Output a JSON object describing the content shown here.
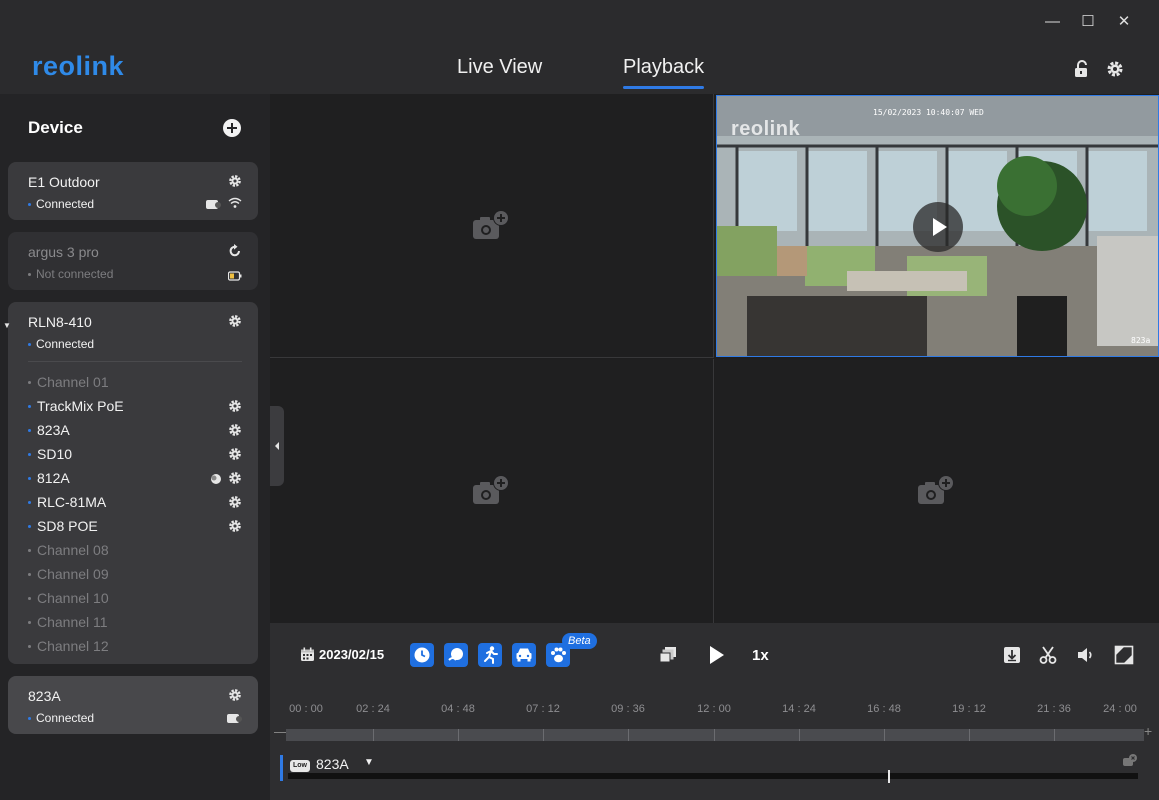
{
  "window_controls": {
    "minimize": "—",
    "maximize": "☐",
    "close": "✕"
  },
  "brand": {
    "logo_text": "reolink",
    "accent": "#2f7ae5"
  },
  "nav": {
    "live_view": "Live View",
    "playback": "Playback",
    "active": "Playback"
  },
  "sidebar": {
    "title": "Device",
    "devices": [
      {
        "name": "E1 Outdoor",
        "status": "Connected"
      },
      {
        "name": "argus 3 pro",
        "status": "Not connected"
      },
      {
        "name": "RLN8-410",
        "status": "Connected",
        "channels": [
          {
            "name": "Channel 01",
            "active": false
          },
          {
            "name": "TrackMix PoE",
            "active": true
          },
          {
            "name": "823A",
            "active": true
          },
          {
            "name": "SD10",
            "active": true
          },
          {
            "name": "812A",
            "active": true
          },
          {
            "name": "RLC-81MA",
            "active": true
          },
          {
            "name": "SD8 POE",
            "active": true
          },
          {
            "name": "Channel 08",
            "active": false
          },
          {
            "name": "Channel 09",
            "active": false
          },
          {
            "name": "Channel 10",
            "active": false
          },
          {
            "name": "Channel 11",
            "active": false
          },
          {
            "name": "Channel 12",
            "active": false
          }
        ]
      },
      {
        "name": "823A",
        "status": "Connected"
      }
    ]
  },
  "feed": {
    "timestamp": "15/02/2023 10:40:07 WED",
    "watermark": "reolink",
    "camera_label": "823a"
  },
  "controls": {
    "date": "2023/02/15",
    "beta_label": "Beta",
    "speed": "1x"
  },
  "timeline": {
    "labels": [
      "00 : 00",
      "02 : 24",
      "04 : 48",
      "07 : 12",
      "09 : 36",
      "12 : 00",
      "14 : 24",
      "16 : 48",
      "19 : 12",
      "21 : 36",
      "24 : 00"
    ],
    "minus": "—",
    "plus": "+",
    "track": {
      "quality": "Low",
      "name": "823A",
      "caret": "▼"
    }
  }
}
